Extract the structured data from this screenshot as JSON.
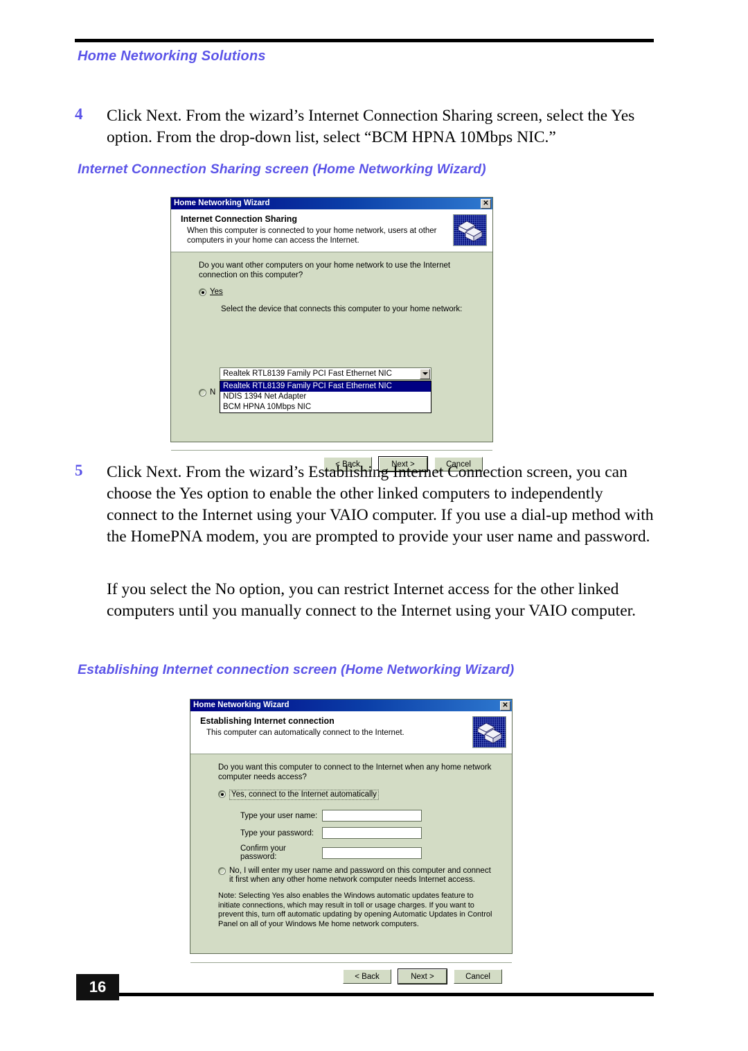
{
  "running_head": "Home Networking Solutions",
  "page_number": "16",
  "steps": [
    {
      "number": "4",
      "text": "Click Next. From the wizard’s Internet Connection Sharing screen, select the Yes option. From the drop-down list, select “BCM HPNA 10Mbps NIC.”"
    },
    {
      "number": "5",
      "text": "Click Next. From the wizard’s Establishing Internet Connection screen, you can choose the Yes option to enable the other linked computers to independently connect to the Internet using your VAIO computer. If you use a dial-up method with the HomePNA modem, you are prompted to provide your user name and password."
    }
  ],
  "paragraph_continued": "If you select the No option, you can restrict Internet access for the other linked computers until you manually connect to the Internet using your VAIO computer.",
  "captions": {
    "figure1": "Internet Connection Sharing screen (Home Networking Wizard)",
    "figure2": "Establishing Internet connection screen (Home Networking Wizard)"
  },
  "colors": {
    "accent": "#5b54e8",
    "dialog_body": "#d3dcc5",
    "titlebar": "#000082",
    "selection": "#000082"
  },
  "dialog1": {
    "window_title": "Home Networking Wizard",
    "close_label": "✕",
    "header_title": "Internet Connection Sharing",
    "header_sub": "When this computer is connected to your home network, users at other computers in your home can access the Internet.",
    "question": "Do you want other computers on your home network to use the Internet connection on this computer?",
    "radio_yes": "Yes",
    "radio_yes_selected": true,
    "radio_no_partial": "N",
    "select_prompt": "Select the device that connects this computer to your home network:",
    "combo_value": "Realtek RTL8139 Family PCI Fast Ethernet NIC",
    "dropdown_options": [
      "Realtek RTL8139 Family PCI Fast Ethernet NIC",
      "NDIS 1394 Net Adapter",
      "BCM HPNA 10Mbps NIC"
    ],
    "dropdown_selected_index": 0,
    "buttons": {
      "back": "< Back",
      "next": "Next >",
      "cancel": "Cancel"
    }
  },
  "dialog2": {
    "window_title": "Home Networking Wizard",
    "close_label": "✕",
    "header_title": "Establishing Internet connection",
    "header_sub": "This computer can automatically connect to the Internet.",
    "question": "Do you want this computer to connect to the Internet when any home network computer needs access?",
    "radio_yes": "Yes, connect to the Internet automatically",
    "radio_yes_selected": true,
    "fields": [
      {
        "label": "Type your user name:",
        "value": ""
      },
      {
        "label": "Type your password:",
        "value": ""
      },
      {
        "label": "Confirm your password:",
        "value": ""
      }
    ],
    "radio_no": "No, I will enter my user name and password on this computer and connect it first when any other home network computer needs Internet access.",
    "note": "Note: Selecting Yes also enables the Windows automatic updates feature to initiate connections, which may result in toll or usage charges. If you want to prevent this, turn off automatic updating by opening Automatic Updates in Control Panel on all of your Windows Me home network computers.",
    "buttons": {
      "back": "< Back",
      "next": "Next >",
      "cancel": "Cancel"
    }
  }
}
